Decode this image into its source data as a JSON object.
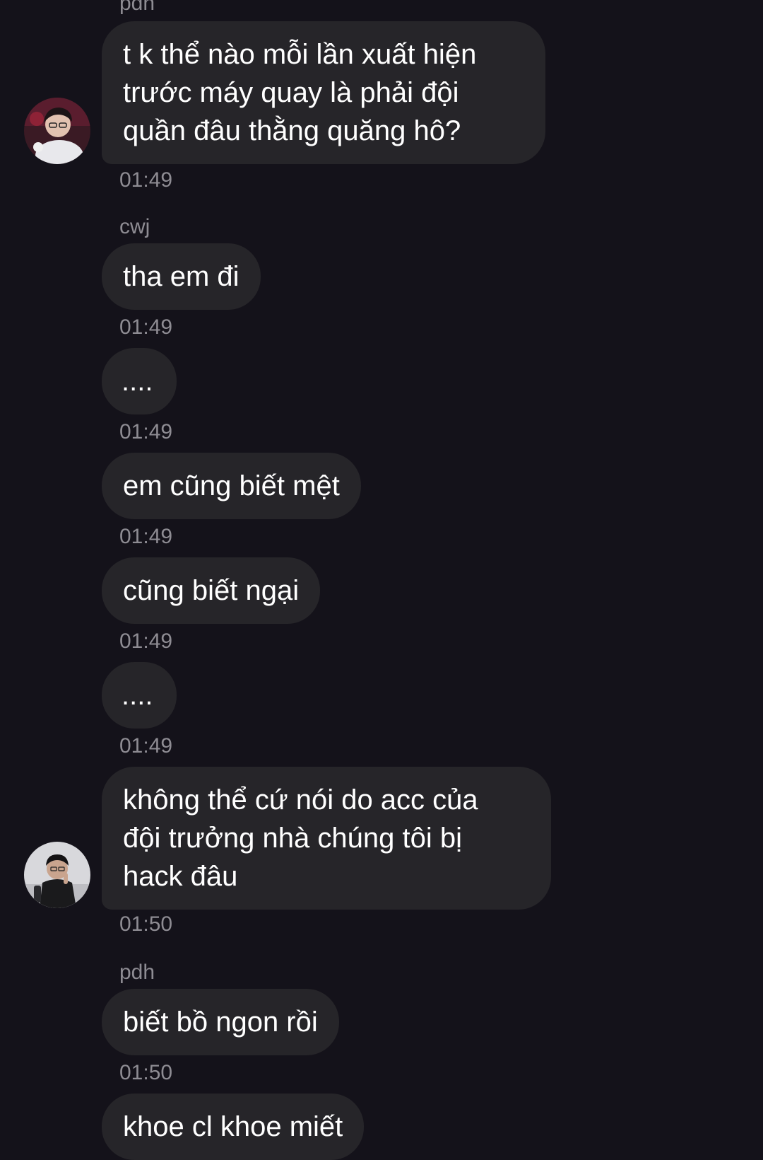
{
  "messages": [
    {
      "sender": "pdh",
      "lines": [
        "t k thể nào mỗi lần xuất hiện",
        "trước máy quay là phải đội",
        "quần đâu thằng quăng hô?"
      ],
      "time": "01:49"
    },
    {
      "sender": "cwj",
      "text": "tha em đi",
      "time": "01:49"
    },
    {
      "text": "....",
      "time": "01:49"
    },
    {
      "text": "em cũng biết mệt",
      "time": "01:49"
    },
    {
      "text": "cũng biết ngại",
      "time": "01:49"
    },
    {
      "text": "....",
      "time": "01:49"
    },
    {
      "lines": [
        "không thể cứ nói do acc của",
        "đội trưởng nhà chúng tôi bị",
        "hack đâu"
      ],
      "time": "01:50"
    },
    {
      "sender": "pdh",
      "text": "biết bồ ngon rồi",
      "time": "01:50"
    },
    {
      "text": "khoe cl khoe miết"
    }
  ]
}
